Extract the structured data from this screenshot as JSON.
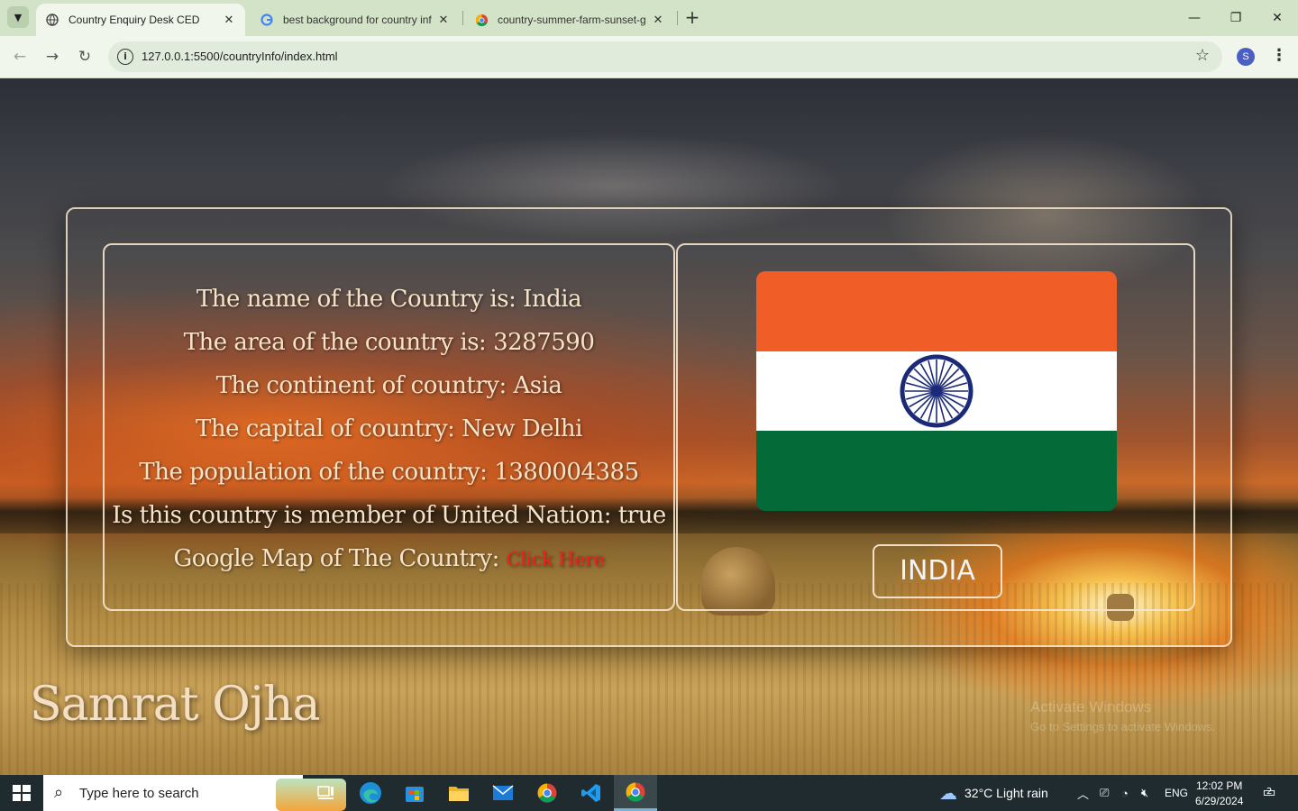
{
  "browser": {
    "tabs": [
      {
        "title": "Country Enquiry Desk CED",
        "active": true,
        "favicon": "globe-icon"
      },
      {
        "title": "best background for country inf",
        "active": false,
        "favicon": "google-icon"
      },
      {
        "title": "country-summer-farm-sunset-g",
        "active": false,
        "favicon": "chrome-icon"
      }
    ],
    "url": "127.0.0.1:5500/countryInfo/index.html",
    "profile_initial": "S"
  },
  "page": {
    "info_lines": {
      "name": "The name of the Country is: India",
      "area": "The area of the country is: 3287590",
      "continent": "The continent of country: Asia",
      "capital": "The capital of country: New Delhi",
      "population": "The population of the country: 1380004385",
      "un_member": "Is this country is member of United Nation: true",
      "map_label": "Google Map of The Country: ",
      "map_link": "Click Here"
    },
    "flag": {
      "colors": {
        "saffron": "#f15d26",
        "white": "#ffffff",
        "green": "#046a38",
        "chakra": "#1b2a78"
      }
    },
    "country_button": "INDIA",
    "author": "Samrat Ojha",
    "watermark": {
      "line1": "Activate Windows",
      "line2": "Go to Settings to activate Windows."
    }
  },
  "taskbar": {
    "search_placeholder": "Type here to search",
    "weather": "32°C  Light rain",
    "language": "ENG",
    "time": "12:02 PM",
    "date": "6/29/2024",
    "notification_count": "2"
  }
}
